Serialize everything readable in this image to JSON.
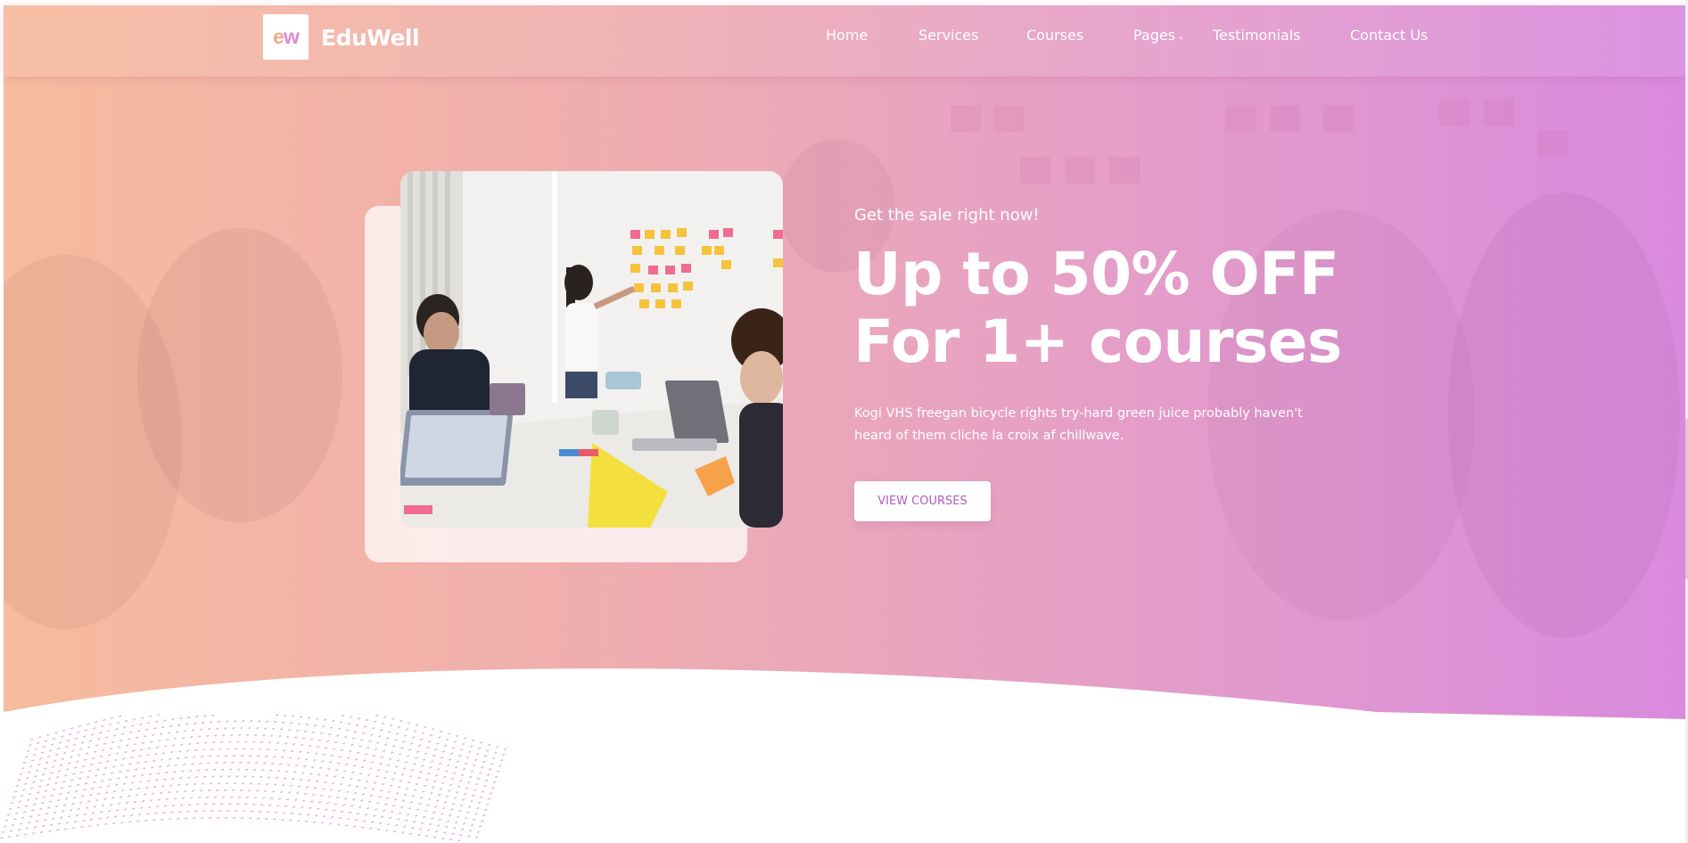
{
  "brand": {
    "logo_letters": {
      "e": "e",
      "w": "w"
    },
    "name": "EduWell"
  },
  "nav": {
    "items": [
      {
        "label": "Home"
      },
      {
        "label": "Services"
      },
      {
        "label": "Courses"
      },
      {
        "label": "Pages",
        "has_dropdown": true
      },
      {
        "label": "Testimonials"
      },
      {
        "label": "Contact Us"
      }
    ]
  },
  "hero": {
    "kicker": "Get the sale right now!",
    "headline_line1": "Up to 50% OFF",
    "headline_line2": "For 1+ courses",
    "description": "Kogi VHS freegan bicycle rights try-hard green juice probably haven't heard of them cliche la croix af chillwave.",
    "cta_label": "VIEW COURSES"
  },
  "colors": {
    "gradient_start": "#f7bb9e",
    "gradient_end": "#d98ade",
    "cta_text": "#b45bbd"
  },
  "icons": {
    "pages_dropdown": "chevron-down-icon"
  }
}
